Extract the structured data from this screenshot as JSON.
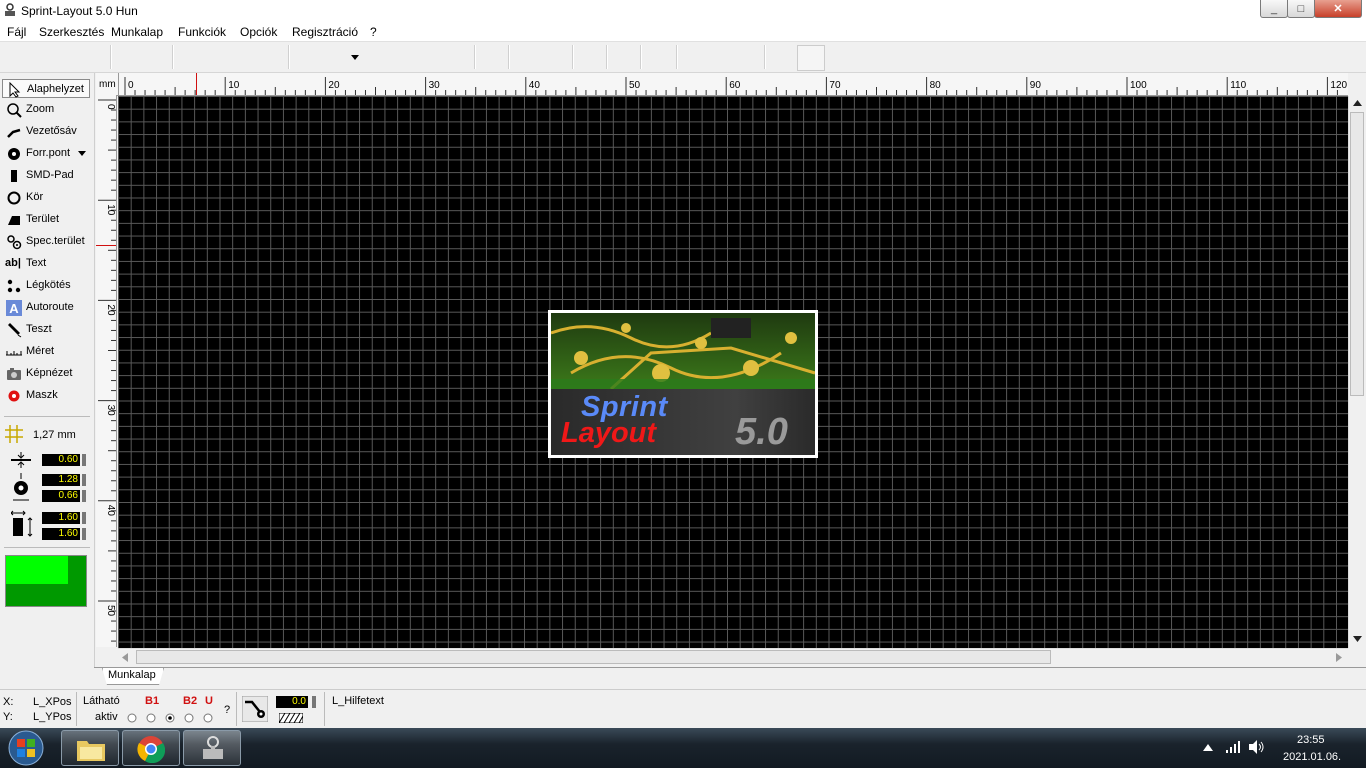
{
  "window": {
    "title": "Sprint-Layout 5.0 Hun",
    "minimize_glyph": "_",
    "maximize_glyph": "□",
    "close_glyph": "✕"
  },
  "menu": [
    "Fájl",
    "Szerkesztés",
    "Munkalap",
    "Funkciók",
    "Opciók",
    "Regisztráció",
    "?"
  ],
  "tools": [
    {
      "label": "Alaphelyzet",
      "icon": "pointer-icon",
      "active": true
    },
    {
      "label": "Zoom",
      "icon": "zoom-icon"
    },
    {
      "label": "Vezetősáv",
      "icon": "track-icon"
    },
    {
      "label": "Forr.pont",
      "icon": "pad-icon"
    },
    {
      "label": "SMD-Pad",
      "icon": "smd-pad-icon"
    },
    {
      "label": "Kör",
      "icon": "circle-icon"
    },
    {
      "label": "Terület",
      "icon": "area-icon"
    },
    {
      "label": "Spec.terület",
      "icon": "special-area-icon"
    },
    {
      "label": "Text",
      "icon": "text-icon"
    },
    {
      "label": "Légkötés",
      "icon": "airwire-icon"
    },
    {
      "label": "Autoroute",
      "icon": "autoroute-icon"
    },
    {
      "label": "Teszt",
      "icon": "test-icon"
    },
    {
      "label": "Méret",
      "icon": "measure-icon"
    },
    {
      "label": "Képnézet",
      "icon": "photo-view-icon"
    },
    {
      "label": "Maszk",
      "icon": "mask-icon"
    }
  ],
  "params": {
    "grid": "1,27 mm",
    "track_width": "0.60",
    "pad_outer": "1.28",
    "pad_inner": "0.66",
    "smd_w": "1.60",
    "smd_h": "1.60"
  },
  "ruler": {
    "unit": "mm",
    "h_ticks": [
      "0",
      "10",
      "20",
      "30",
      "40",
      "50",
      "60",
      "70",
      "80",
      "90",
      "100",
      "110",
      "120"
    ],
    "v_ticks": [
      "0",
      "10",
      "20",
      "30",
      "40",
      "50"
    ]
  },
  "splash": {
    "line1": "Sprint",
    "line2": "Layout",
    "version": "5.0"
  },
  "tab": "Munkalap",
  "status": {
    "x_label": "X:",
    "y_label": "Y:",
    "x_value": "L_XPos",
    "y_value": "L_YPos",
    "visible_label": "Látható",
    "active_label": "aktiv",
    "layers": [
      "B1",
      "B2",
      "U"
    ],
    "question": "?",
    "zoom_value": "0.0",
    "hint": "L_Hilfetext"
  },
  "taskbar": {
    "time": "23:55",
    "date": "2021.01.06."
  },
  "colors": {
    "canvas": "#000000",
    "grid": "#5a5a5a",
    "layer_red": "#d01010",
    "swatch_light": "#00ff00",
    "swatch_dark": "#009900"
  }
}
